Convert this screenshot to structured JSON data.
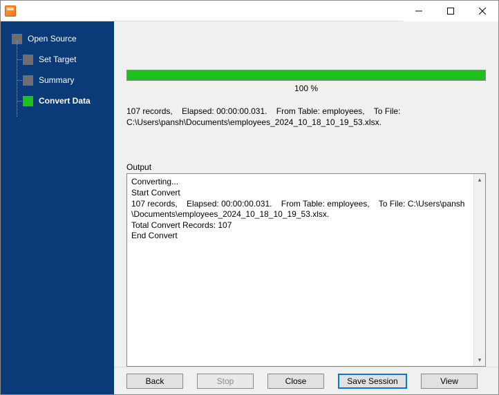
{
  "nav": {
    "root": "Open Source",
    "children": [
      "Set Target",
      "Summary",
      "Convert Data"
    ],
    "activeIndex": 2
  },
  "progress": {
    "percent": 100,
    "label": "100 %"
  },
  "status": "107 records,    Elapsed: 00:00:00.031.    From Table: employees,    To File:\nC:\\Users\\pansh\\Documents\\employees_2024_10_18_10_19_53.xlsx.",
  "outputLabel": "Output",
  "output": "Converting...\nStart Convert\n107 records,    Elapsed: 00:00:00.031.    From Table: employees,    To File: C:\\Users\\pansh\n\\Documents\\employees_2024_10_18_10_19_53.xlsx.\nTotal Convert Records: 107\nEnd Convert",
  "buttons": {
    "back": "Back",
    "stop": "Stop",
    "close": "Close",
    "saveSession": "Save Session",
    "view": "View"
  }
}
